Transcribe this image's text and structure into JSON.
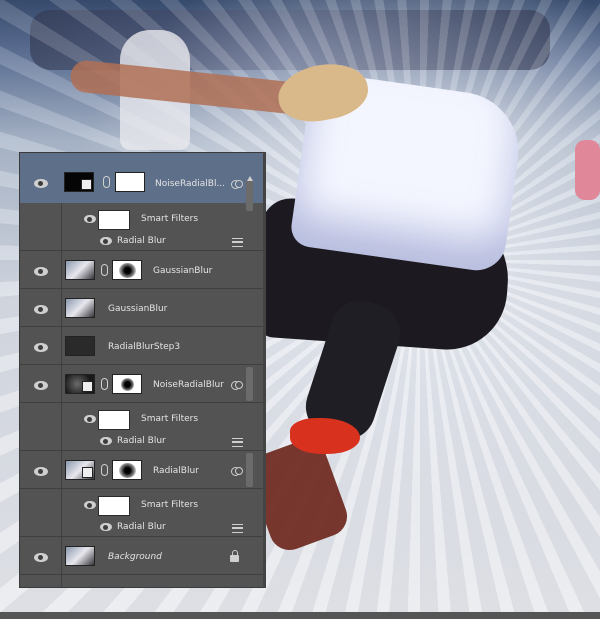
{
  "panel": {
    "layers": [
      {
        "name": "NoiseRadialBl...",
        "selected": true,
        "has_mask": true,
        "smart_object": true
      },
      {
        "filter_group": "Smart Filters",
        "filter": "Radial Blur"
      },
      {
        "name": "GaussianBlur",
        "has_mask": true
      },
      {
        "name": "GaussianBlur"
      },
      {
        "name": "RadialBlurStep3"
      },
      {
        "name": "NoiseRadialBlur",
        "has_mask": true,
        "smart_object": true
      },
      {
        "filter_group": "Smart Filters",
        "filter": "Radial Blur"
      },
      {
        "name": "RadialBlur",
        "has_mask": true,
        "smart_object": true
      },
      {
        "filter_group": "Smart Filters",
        "filter": "Radial Blur"
      },
      {
        "name": "Background",
        "locked": true
      }
    ],
    "labels": {
      "l1": "NoiseRadialBl...",
      "sf1": "Smart Filters",
      "rb1": "Radial Blur",
      "l2": "GaussianBlur",
      "l3": "GaussianBlur",
      "l4": "RadialBlurStep3",
      "l5": "NoiseRadialBlur",
      "sf2": "Smart Filters",
      "rb2": "Radial Blur",
      "l6": "RadialBlur",
      "sf3": "Smart Filters",
      "rb3": "Radial Blur",
      "bg": "Background"
    }
  },
  "colors": {
    "panel_bg": "#535353",
    "selected_row": "#5e6f8a",
    "text": "#e4e4e4"
  }
}
